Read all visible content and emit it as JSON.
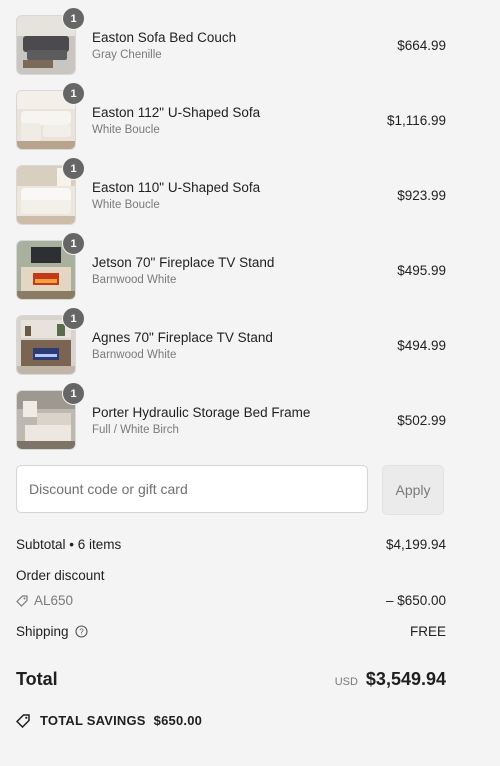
{
  "items": [
    {
      "name": "Easton Sofa Bed Couch",
      "variant": "Gray Chenille",
      "price": "$664.99",
      "qty": "1",
      "image": "gray-sofa-bed-image"
    },
    {
      "name": "Easton 112\" U-Shaped Sofa",
      "variant": "White Boucle",
      "price": "$1,116.99",
      "qty": "1",
      "image": "white-u-sofa-image"
    },
    {
      "name": "Easton 110\" U-Shaped Sofa",
      "variant": "White Boucle",
      "price": "$923.99",
      "qty": "1",
      "image": "white-u-sofa-image"
    },
    {
      "name": "Jetson 70\" Fireplace TV Stand",
      "variant": "Barnwood White",
      "price": "$495.99",
      "qty": "1",
      "image": "fireplace-tv-stand-image"
    },
    {
      "name": "Agnes 70\" Fireplace TV Stand",
      "variant": "Barnwood White",
      "price": "$494.99",
      "qty": "1",
      "image": "fireplace-tv-stand-image"
    },
    {
      "name": "Porter Hydraulic Storage Bed Frame",
      "variant": "Full / White Birch",
      "price": "$502.99",
      "qty": "1",
      "image": "storage-bed-image"
    }
  ],
  "discount": {
    "placeholder": "Discount code or gift card",
    "apply_label": "Apply"
  },
  "summary": {
    "subtotal_label": "Subtotal • 6 items",
    "subtotal_value": "$4,199.94",
    "order_discount_label": "Order discount",
    "discount_code": "AL650",
    "discount_value": "– $650.00",
    "shipping_label": "Shipping",
    "shipping_value": "FREE",
    "total_label": "Total",
    "currency": "USD",
    "total_value": "$3,549.94",
    "savings_label": "TOTAL SAVINGS",
    "savings_value": "$650.00"
  },
  "colors": {
    "background": "#f4f4f4",
    "badge": "#666666",
    "muted_text": "#7a7a7a"
  }
}
